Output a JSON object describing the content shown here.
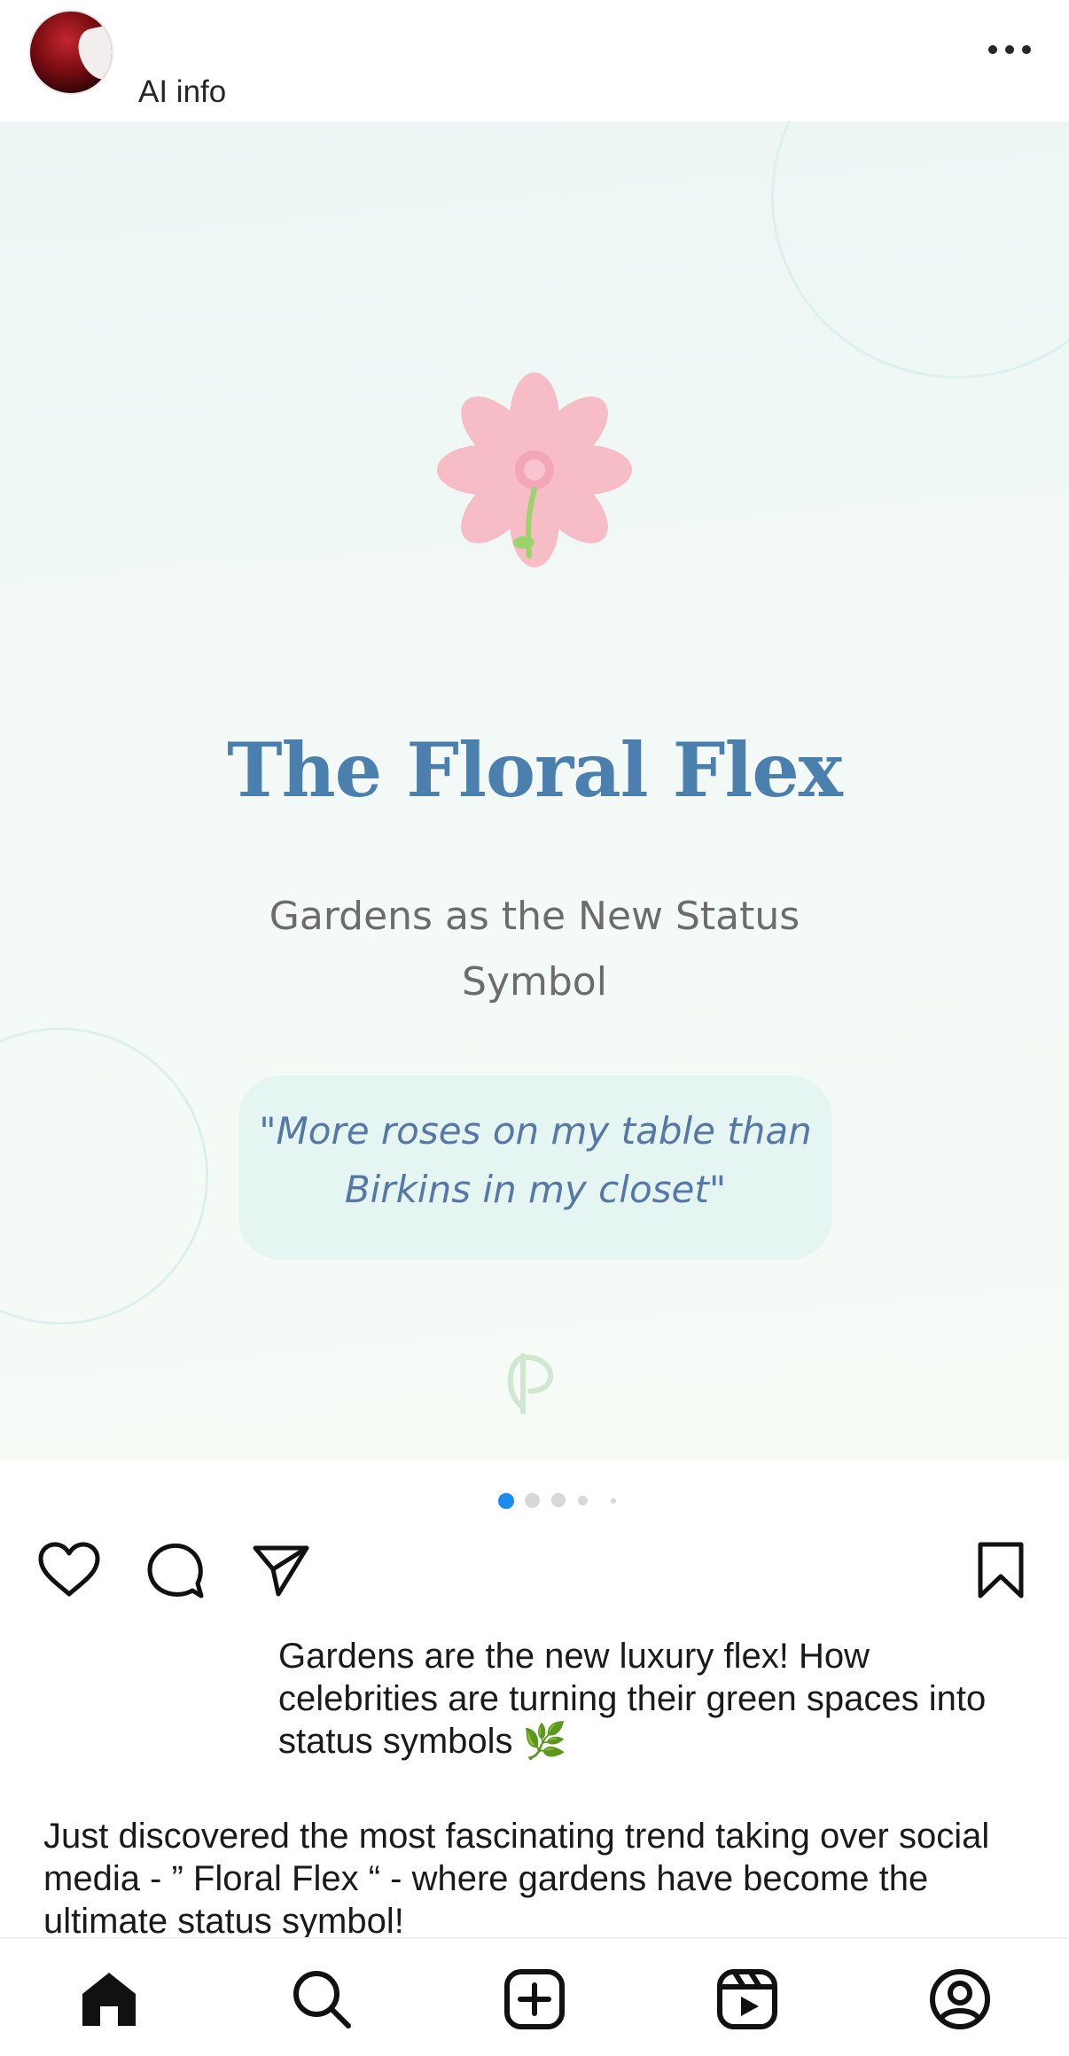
{
  "header": {
    "subtitle": "AI info",
    "more_icon": "more-horizontal-icon"
  },
  "post": {
    "title": "The Floral Flex",
    "subtitle": "Gardens as the New Status Symbol",
    "quote": "\"More roses on my table than Birkins in my closet\"",
    "carousel": {
      "current_index": 1,
      "visible_dots": 5
    },
    "colors": {
      "title": "#4a7fae",
      "accent_dot": "#1a8cf0",
      "flower": "#f7b8c4",
      "quote_bg": "#e5f5f1"
    }
  },
  "actions": {
    "like_icon": "heart-icon",
    "comment_icon": "comment-icon",
    "share_icon": "send-icon",
    "save_icon": "bookmark-icon"
  },
  "caption": {
    "line1": "Gardens are the new luxury flex! How celebrities are turning their green spaces into status symbols 🌿",
    "para2": "Just discovered the most fascinating trend taking over social media - ” Floral Flex “ - where gardens have become the ultimate status symbol!"
  },
  "nav": {
    "items": [
      "home-icon",
      "search-icon",
      "create-icon",
      "reels-icon",
      "profile-icon"
    ]
  }
}
